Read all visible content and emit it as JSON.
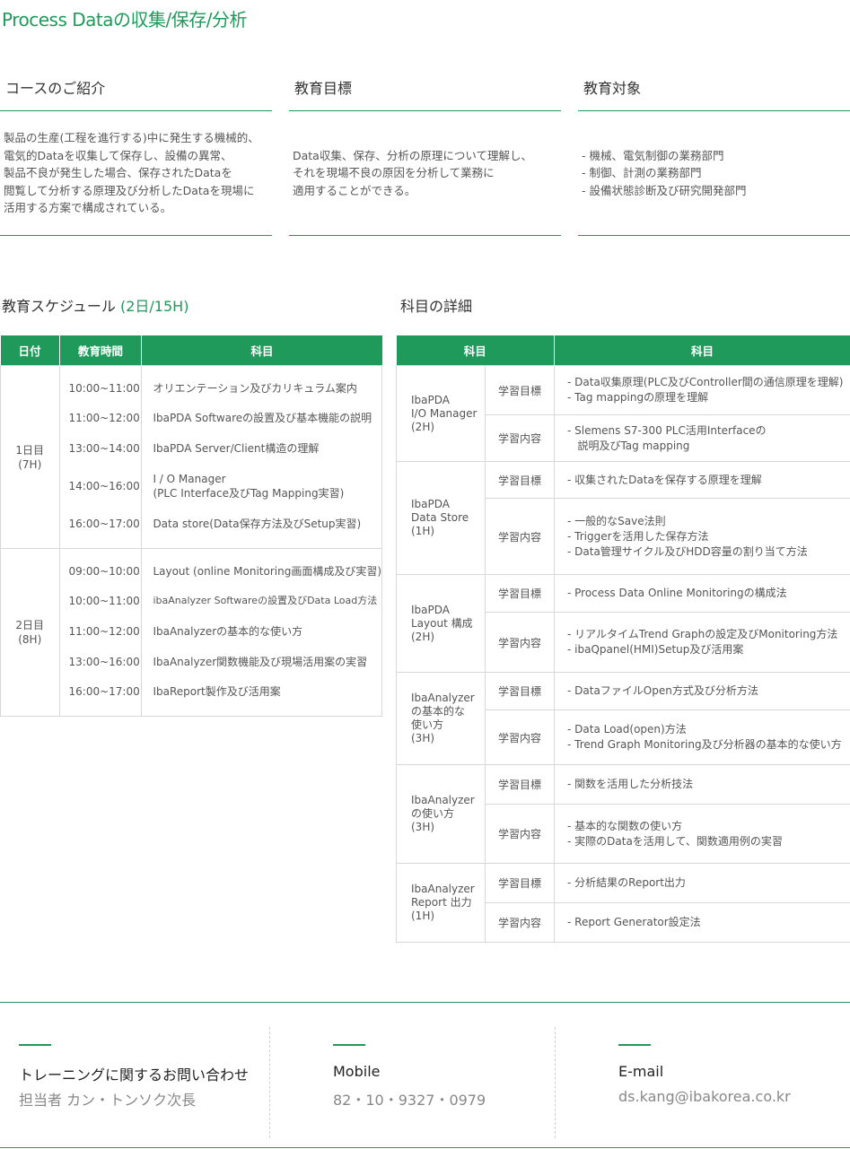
{
  "title": "Process Dataの収集/保存/分析",
  "intro": [
    {
      "heading": "コースのご紹介",
      "lines": [
        "製品の生産(工程を進行する)中に発生する機械的、",
        "電気的Dataを収集して保存し、設備の異常、",
        "製品不良が発生した場合、保存されたDataを",
        "閲覧して分析する原理及び分析したDataを現場に",
        "活用する方案で構成されている。"
      ]
    },
    {
      "heading": "教育目標",
      "lines": [
        "Data収集、保存、分析の原理について理解し、",
        "それを現場不良の原因を分析して業務に",
        "適用することができる。"
      ]
    },
    {
      "heading": "教育対象",
      "lines": [
        "- 機械、電気制御の業務部門",
        "- 制御、計測の業務部門",
        "- 設備状態診断及び研究開発部門"
      ]
    }
  ],
  "schedule": {
    "heading": "教育スケジュール",
    "heading_accent": "(2日/15H)",
    "columns": [
      "日付",
      "教育時間",
      "科目"
    ],
    "days": [
      {
        "day": "1日目",
        "hours": "(7H)",
        "rows": [
          {
            "time": "10:00~11:00",
            "subject": [
              "オリエンテーション及びカリキュラム案内"
            ]
          },
          {
            "time": "11:00~12:00",
            "subject": [
              "IbaPDA Softwareの設置及び基本機能の説明"
            ]
          },
          {
            "time": "13:00~14:00",
            "subject": [
              "IbaPDA Server/Client構造の理解"
            ]
          },
          {
            "time": "14:00~16:00",
            "subject": [
              "I / O Manager",
              "(PLC Interface及びTag Mapping実習)"
            ]
          },
          {
            "time": "16:00~17:00",
            "subject": [
              "Data store(Data保存方法及びSetup実習)"
            ]
          }
        ]
      },
      {
        "day": "2日目",
        "hours": "(8H)",
        "rows": [
          {
            "time": "09:00~10:00",
            "subject": [
              "Layout (online Monitoring画面構成及び実習)"
            ]
          },
          {
            "time": "10:00~11:00",
            "subject": [
              "ibaAnalyzer Softwareの設置及びData Load方法"
            ]
          },
          {
            "time": "11:00~12:00",
            "subject": [
              "IbaAnalyzerの基本的な使い方"
            ]
          },
          {
            "time": "13:00~16:00",
            "subject": [
              "IbaAnalyzer関数機能及び現場活用案の実習"
            ]
          },
          {
            "time": "16:00~17:00",
            "subject": [
              "IbaReport製作及び活用案"
            ]
          }
        ]
      }
    ]
  },
  "detail": {
    "heading": "科目の詳細",
    "columns": [
      "科目",
      "科目"
    ],
    "groups": [
      {
        "subject": [
          "IbaPDA",
          "I/O Manager",
          "(2H)"
        ],
        "rows": [
          {
            "kind": "学習目標",
            "lines": [
              "- Data収集原理(PLC及びController間の通信原理を理解)",
              "- Tag mappingの原理を理解"
            ]
          },
          {
            "kind": "学習内容",
            "lines": [
              "- Slemens S7-300 PLC活用Interfaceの",
              "   説明及びTag mapping"
            ]
          }
        ]
      },
      {
        "subject": [
          "IbaPDA",
          "Data Store",
          "(1H)"
        ],
        "rows": [
          {
            "kind": "学習目標",
            "lines": [
              "- 収集されたDataを保存する原理を理解"
            ]
          },
          {
            "kind": "学習内容",
            "lines": [
              "- 一般的なSave法則",
              "- Triggerを活用した保存方法",
              "- Data管理サイクル及びHDD容量の割り当て方法"
            ]
          }
        ]
      },
      {
        "subject": [
          "IbaPDA",
          "Layout 構成",
          "(2H)"
        ],
        "rows": [
          {
            "kind": "学習目標",
            "lines": [
              "- Process Data Online Monitoringの構成法"
            ]
          },
          {
            "kind": "学習内容",
            "lines": [
              "- リアルタイムTrend Graphの設定及びMonitoring方法",
              "- ibaQpanel(HMI)Setup及び活用案"
            ]
          }
        ]
      },
      {
        "subject": [
          "IbaAnalyzer",
          "の基本的な",
          "使い方",
          "(3H)"
        ],
        "rows": [
          {
            "kind": "学習目標",
            "lines": [
              "- DataファイルOpen方式及び分析方法"
            ]
          },
          {
            "kind": "学習内容",
            "lines": [
              "- Data Load(open)方法",
              "- Trend Graph Monitoring及び分析器の基本的な使い方"
            ]
          }
        ]
      },
      {
        "subject": [
          "IbaAnalyzer",
          "の使い方",
          "(3H)"
        ],
        "rows": [
          {
            "kind": "学習目標",
            "lines": [
              "- 関数を活用した分析技法"
            ]
          },
          {
            "kind": "学習内容",
            "lines": [
              "- 基本的な関数の使い方",
              "- 実際のDataを活用して、関数適用例の実習"
            ]
          }
        ]
      },
      {
        "subject": [
          "IbaAnalyzer",
          "Report 出力",
          "(1H)"
        ],
        "rows": [
          {
            "kind": "学習目標",
            "lines": [
              "- 分析結果のReport出力"
            ]
          },
          {
            "kind": "学習内容",
            "lines": [
              "- Report Generator設定法"
            ]
          }
        ]
      }
    ]
  },
  "contact": [
    {
      "label": "トレーニングに関するお問い合わせ",
      "value": "担当者 カン・トンソク次長"
    },
    {
      "label": "Mobile",
      "value": "82・10・9327・0979"
    },
    {
      "label": "E-mail",
      "value": "ds.kang@ibakorea.co.kr"
    }
  ]
}
